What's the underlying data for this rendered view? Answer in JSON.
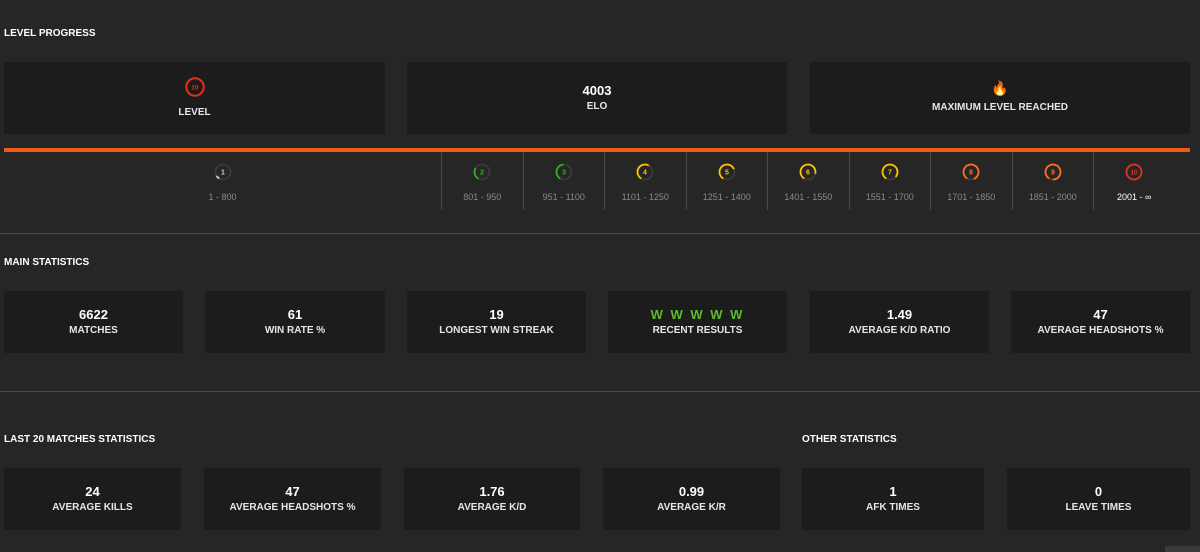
{
  "level_progress": {
    "title": "LEVEL PROGRESS",
    "level_card": {
      "value": "10",
      "label": "LEVEL",
      "color": "#e5311c"
    },
    "elo_card": {
      "value": "4003",
      "label": "ELO"
    },
    "max_card": {
      "icon": "fire-icon",
      "label": "MAXIMUM LEVEL REACHED"
    },
    "accent_color": "#f05a17",
    "levels": [
      {
        "level": "1",
        "range": "1 - 800",
        "color": "#cfcfcf",
        "fill": 0.08
      },
      {
        "level": "2",
        "range": "801 - 950",
        "color": "#2fb31f",
        "fill": 0.25
      },
      {
        "level": "3",
        "range": "951 - 1100",
        "color": "#2fb31f",
        "fill": 0.4
      },
      {
        "level": "4",
        "range": "1101 - 1250",
        "color": "#ffc300",
        "fill": 0.5
      },
      {
        "level": "5",
        "range": "1251 - 1400",
        "color": "#ffc300",
        "fill": 0.6
      },
      {
        "level": "6",
        "range": "1401 - 1550",
        "color": "#ffc300",
        "fill": 0.7
      },
      {
        "level": "7",
        "range": "1551 - 1700",
        "color": "#ffc300",
        "fill": 0.78
      },
      {
        "level": "8",
        "range": "1701 - 1850",
        "color": "#ff6e1c",
        "fill": 0.85
      },
      {
        "level": "9",
        "range": "1851 - 2000",
        "color": "#ff6e1c",
        "fill": 0.92
      },
      {
        "level": "10",
        "range": "2001 - ∞",
        "color": "#e5311c",
        "fill": 1.0
      }
    ]
  },
  "main_statistics": {
    "title": "MAIN STATISTICS",
    "cards": [
      {
        "value": "6622",
        "label": "MATCHES"
      },
      {
        "value": "61",
        "label": "WIN RATE %"
      },
      {
        "value": "19",
        "label": "LONGEST WIN STREAK"
      },
      {
        "value": "W W W W W",
        "label": "RECENT RESULTS",
        "color": "#5fba2a"
      },
      {
        "value": "1.49",
        "label": "AVERAGE K/D RATIO"
      },
      {
        "value": "47",
        "label": "AVERAGE HEADSHOTS %"
      }
    ]
  },
  "last20": {
    "title": "LAST 20 MATCHES STATISTICS",
    "cards": [
      {
        "value": "24",
        "label": "AVERAGE KILLS"
      },
      {
        "value": "47",
        "label": "AVERAGE HEADSHOTS %"
      },
      {
        "value": "1.76",
        "label": "AVERAGE K/D"
      },
      {
        "value": "0.99",
        "label": "AVERAGE K/R"
      }
    ]
  },
  "other": {
    "title": "OTHER STATISTICS",
    "cards": [
      {
        "value": "1",
        "label": "AFK TIMES"
      },
      {
        "value": "0",
        "label": "LEAVE TIMES"
      }
    ]
  }
}
